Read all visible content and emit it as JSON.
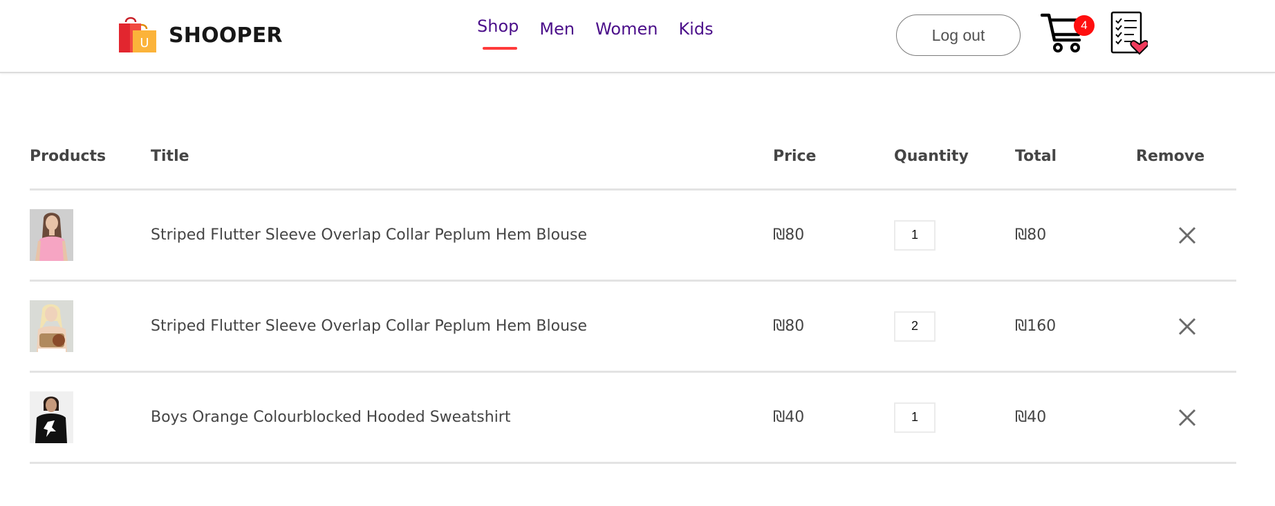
{
  "brand": {
    "name": "SHOOPER",
    "logo_icon": "shopping-bags-icon",
    "logo_letter": "U"
  },
  "nav": {
    "items": [
      {
        "label": "Shop",
        "active": true
      },
      {
        "label": "Men",
        "active": false
      },
      {
        "label": "Women",
        "active": false
      },
      {
        "label": "Kids",
        "active": false
      }
    ],
    "link_color": "#4b0f8a",
    "underline_color": "#ff3b3b"
  },
  "header_actions": {
    "auth_label": "Log out",
    "cart_icon": "cart-icon",
    "cart_count": "4",
    "badge_color": "#ff0f0f",
    "orders_icon": "order-list-heart-icon"
  },
  "cart": {
    "columns": [
      "Products",
      "Title",
      "Price",
      "Quantity",
      "Total",
      "Remove"
    ],
    "remove_icon": "close-icon",
    "items": [
      {
        "thumbnail": "woman-pink-top-photo",
        "title": "Striped Flutter Sleeve Overlap Collar Peplum Hem Blouse",
        "price": "₪80",
        "quantity": "1",
        "total": "₪80"
      },
      {
        "thumbnail": "woman-crop-top-photo",
        "title": "Striped Flutter Sleeve Overlap Collar Peplum Hem Blouse",
        "price": "₪80",
        "quantity": "2",
        "total": "₪160"
      },
      {
        "thumbnail": "boy-black-hoodie-photo",
        "title": "Boys Orange Colourblocked Hooded Sweatshirt",
        "price": "₪40",
        "quantity": "1",
        "total": "₪40"
      }
    ]
  }
}
